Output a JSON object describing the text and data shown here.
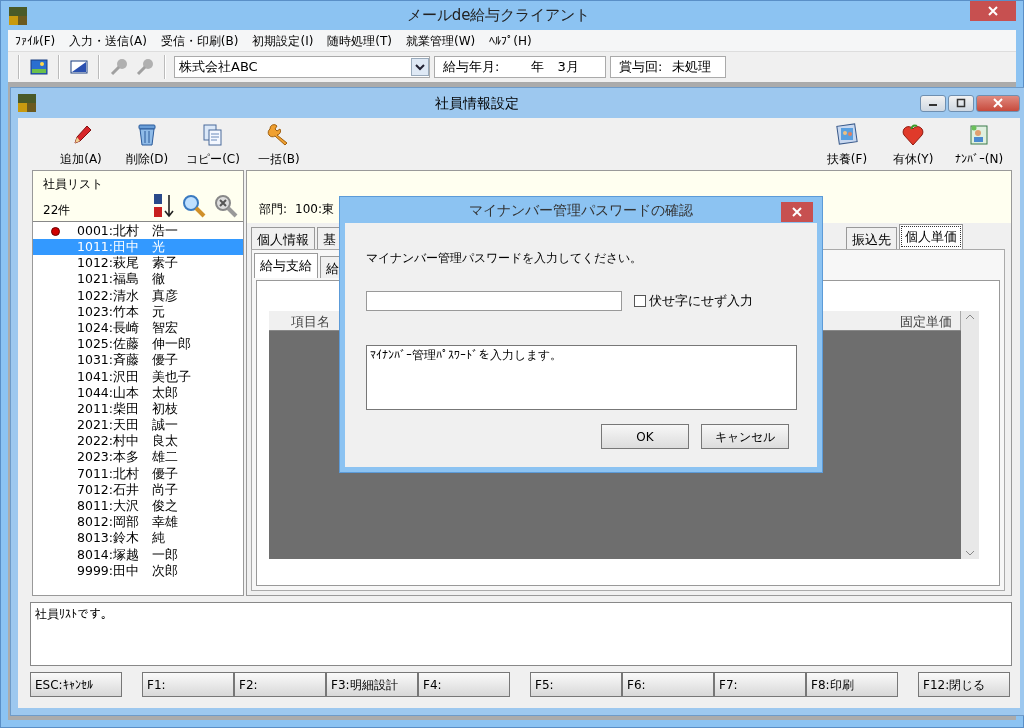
{
  "window": {
    "title": "メールde給与クライアント"
  },
  "menu": [
    "ﾌｧｲﾙ(F)",
    "入力・送信(A)",
    "受信・印刷(B)",
    "初期設定(I)",
    "随時処理(T)",
    "就業管理(W)",
    "ﾍﾙﾌﾟ(H)"
  ],
  "toolbar": {
    "company": {
      "value": "株式会社ABC"
    },
    "pay_month": {
      "label": "給与年月:",
      "value": "年　3月"
    },
    "bonus": {
      "label": "賞与回:",
      "value": "未処理"
    }
  },
  "child_window": {
    "title": "社員情報設定"
  },
  "actions_left": [
    {
      "label": "追加(A)",
      "kind": "add"
    },
    {
      "label": "削除(D)",
      "kind": "delete"
    },
    {
      "label": "コピー(C)",
      "kind": "copy"
    },
    {
      "label": "一括(B)",
      "kind": "batch"
    }
  ],
  "actions_right": [
    {
      "label": "扶養(F)",
      "kind": "family"
    },
    {
      "label": "有休(Y)",
      "kind": "leave"
    },
    {
      "label": "ﾅﾝﾊﾞｰ(N)",
      "kind": "number"
    }
  ],
  "employee_list": {
    "title": "社員リスト",
    "count": "22件",
    "items": [
      {
        "text": "0001:北村　浩一",
        "marked": true,
        "selected": false
      },
      {
        "text": "1011:田中　光",
        "marked": false,
        "selected": true
      },
      {
        "text": "1012:萩尾　素子",
        "marked": false,
        "selected": false
      },
      {
        "text": "1021:福島　徹",
        "marked": false,
        "selected": false
      },
      {
        "text": "1022:清水　真彦",
        "marked": false,
        "selected": false
      },
      {
        "text": "1023:竹本　元",
        "marked": false,
        "selected": false
      },
      {
        "text": "1024:長崎　智宏",
        "marked": false,
        "selected": false
      },
      {
        "text": "1025:佐藤　伸一郎",
        "marked": false,
        "selected": false
      },
      {
        "text": "1031:斉藤　優子",
        "marked": false,
        "selected": false
      },
      {
        "text": "1041:沢田　美也子",
        "marked": false,
        "selected": false
      },
      {
        "text": "1044:山本　太郎",
        "marked": false,
        "selected": false
      },
      {
        "text": "2011:柴田　初枝",
        "marked": false,
        "selected": false
      },
      {
        "text": "2021:天田　誠一",
        "marked": false,
        "selected": false
      },
      {
        "text": "2022:村中　良太",
        "marked": false,
        "selected": false
      },
      {
        "text": "2023:本多　雄二",
        "marked": false,
        "selected": false
      },
      {
        "text": "7011:北村　優子",
        "marked": false,
        "selected": false
      },
      {
        "text": "7012:石井　尚子",
        "marked": false,
        "selected": false
      },
      {
        "text": "8011:大沢　俊之",
        "marked": false,
        "selected": false
      },
      {
        "text": "8012:岡部　幸雄",
        "marked": false,
        "selected": false
      },
      {
        "text": "8013:鈴木　純",
        "marked": false,
        "selected": false
      },
      {
        "text": "8014:塚越　一郎",
        "marked": false,
        "selected": false
      },
      {
        "text": "9999:田中　次郎",
        "marked": false,
        "selected": false
      }
    ]
  },
  "department": {
    "label": "部門:",
    "value": "100:東"
  },
  "tabs": [
    {
      "label": "個人情報",
      "selected": false
    },
    {
      "label": "基",
      "selected": false
    },
    {
      "label": "振込先",
      "selected": false
    },
    {
      "label": "個人単価",
      "selected": true
    }
  ],
  "subtabs": [
    {
      "label": "給与支給",
      "selected": true
    },
    {
      "label": "給",
      "selected": false
    }
  ],
  "grid": {
    "columns": [
      "項目名",
      "固定単価"
    ]
  },
  "description": "社員ﾘｽﾄです。",
  "function_keys": [
    [
      "ESC:ｷｬﾝｾﾙ"
    ],
    [
      "F1:",
      "F2:",
      "F3:明細設計",
      "F4:"
    ],
    [
      "F5:",
      "F6:",
      "F7:",
      "F8:印刷"
    ],
    [
      "F12:閉じる"
    ]
  ],
  "dialog": {
    "title": "マイナンバー管理パスワードの確認",
    "prompt": "マイナンバー管理パスワードを入力してください。",
    "checkbox": {
      "label": "伏せ字にせず入力",
      "checked": false
    },
    "help": "ﾏｲﾅﾝﾊﾞｰ管理ﾊﾟｽﾜｰﾄﾞを入力します。",
    "buttons": [
      "OK",
      "キャンセル"
    ]
  }
}
